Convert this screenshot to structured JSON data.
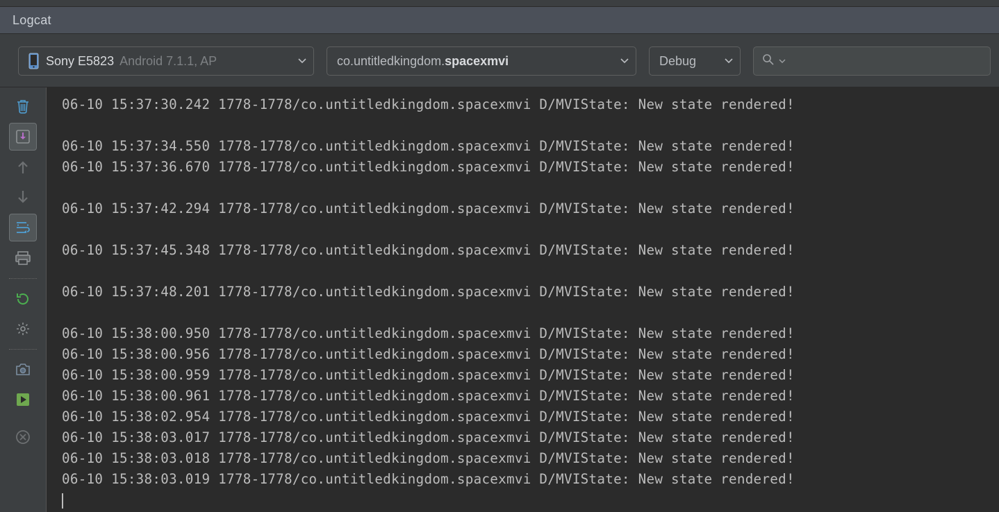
{
  "panel": {
    "title": "Logcat"
  },
  "toolbar": {
    "device_label_main": "Sony E5823",
    "device_label_sub": "Android 7.1.1, AP",
    "process_prefix": "co.untitledkingdom.",
    "process_bold": "spacexmvi",
    "log_level": "Debug",
    "search_placeholder": ""
  },
  "icons": {
    "phone": "phone-icon",
    "trash": "trash-icon",
    "scroll_end": "scroll-to-end-icon",
    "arrow_up": "arrow-up-icon",
    "arrow_down": "arrow-down-icon",
    "soft_wrap": "soft-wrap-icon",
    "print": "print-icon",
    "restart": "restart-icon",
    "settings": "settings-icon",
    "camera": "screenshot-icon",
    "record": "screen-record-icon",
    "clear": "clear-icon",
    "caret": "caret-down-icon",
    "search": "search-icon"
  },
  "log_lines": [
    "06-10 15:37:30.242 1778-1778/co.untitledkingdom.spacexmvi D/MVIState: New state rendered!",
    "",
    "06-10 15:37:34.550 1778-1778/co.untitledkingdom.spacexmvi D/MVIState: New state rendered!",
    "06-10 15:37:36.670 1778-1778/co.untitledkingdom.spacexmvi D/MVIState: New state rendered!",
    "",
    "06-10 15:37:42.294 1778-1778/co.untitledkingdom.spacexmvi D/MVIState: New state rendered!",
    "",
    "06-10 15:37:45.348 1778-1778/co.untitledkingdom.spacexmvi D/MVIState: New state rendered!",
    "",
    "06-10 15:37:48.201 1778-1778/co.untitledkingdom.spacexmvi D/MVIState: New state rendered!",
    "",
    "06-10 15:38:00.950 1778-1778/co.untitledkingdom.spacexmvi D/MVIState: New state rendered!",
    "06-10 15:38:00.956 1778-1778/co.untitledkingdom.spacexmvi D/MVIState: New state rendered!",
    "06-10 15:38:00.959 1778-1778/co.untitledkingdom.spacexmvi D/MVIState: New state rendered!",
    "06-10 15:38:00.961 1778-1778/co.untitledkingdom.spacexmvi D/MVIState: New state rendered!",
    "06-10 15:38:02.954 1778-1778/co.untitledkingdom.spacexmvi D/MVIState: New state rendered!",
    "06-10 15:38:03.017 1778-1778/co.untitledkingdom.spacexmvi D/MVIState: New state rendered!",
    "06-10 15:38:03.018 1778-1778/co.untitledkingdom.spacexmvi D/MVIState: New state rendered!",
    "06-10 15:38:03.019 1778-1778/co.untitledkingdom.spacexmvi D/MVIState: New state rendered!"
  ]
}
